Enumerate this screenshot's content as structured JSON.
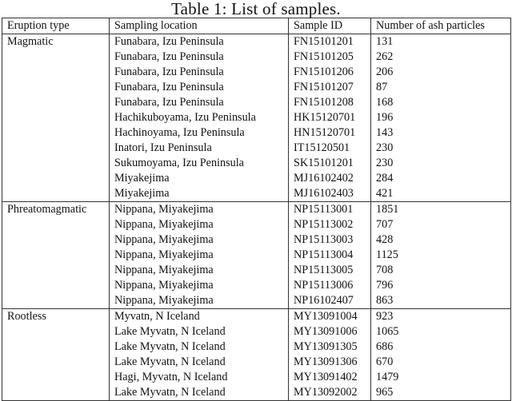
{
  "caption": "Table 1: List of samples.",
  "table": {
    "headers": [
      "Eruption type",
      "Sampling location",
      "Sample ID",
      "Number of ash particles"
    ],
    "groups": [
      {
        "eruption_type": "Magmatic",
        "rows": [
          {
            "location": "Funabara, Izu Peninsula",
            "sample_id": "FN15101201",
            "count": "131"
          },
          {
            "location": "Funabara, Izu Peninsula",
            "sample_id": "FN15101205",
            "count": "262"
          },
          {
            "location": "Funabara, Izu Peninsula",
            "sample_id": "FN15101206",
            "count": "206"
          },
          {
            "location": "Funabara, Izu Peninsula",
            "sample_id": "FN15101207",
            "count": "87"
          },
          {
            "location": "Funabara, Izu Peninsula",
            "sample_id": "FN15101208",
            "count": "168"
          },
          {
            "location": "Hachikuboyama, Izu Peninsula",
            "sample_id": "HK15120701",
            "count": "196"
          },
          {
            "location": "Hachinoyama, Izu Peninsula",
            "sample_id": "HN15120701",
            "count": "143"
          },
          {
            "location": "Inatori, Izu Peninsula",
            "sample_id": "IT15120501",
            "count": "230"
          },
          {
            "location": "Sukumoyama, Izu Peninsula",
            "sample_id": "SK15101201",
            "count": "230"
          },
          {
            "location": "Miyakejima",
            "sample_id": "MJ16102402",
            "count": "284"
          },
          {
            "location": "Miyakejima",
            "sample_id": "MJ16102403",
            "count": "421"
          }
        ]
      },
      {
        "eruption_type": "Phreatomagmatic",
        "rows": [
          {
            "location": "Nippana, Miyakejima",
            "sample_id": "NP15113001",
            "count": "1851"
          },
          {
            "location": "Nippana, Miyakejima",
            "sample_id": "NP15113002",
            "count": "707"
          },
          {
            "location": "Nippana, Miyakejima",
            "sample_id": "NP15113003",
            "count": "428"
          },
          {
            "location": "Nippana, Miyakejima",
            "sample_id": "NP15113004",
            "count": "1125"
          },
          {
            "location": "Nippana, Miyakejima",
            "sample_id": "NP15113005",
            "count": "708"
          },
          {
            "location": "Nippana, Miyakejima",
            "sample_id": "NP15113006",
            "count": "796"
          },
          {
            "location": "Nippana, Miyakejima",
            "sample_id": "NP16102407",
            "count": "863"
          }
        ]
      },
      {
        "eruption_type": "Rootless",
        "rows": [
          {
            "location": "Myvatn, N Iceland",
            "sample_id": "MY13091004",
            "count": "923"
          },
          {
            "location": "Lake Myvatn, N Iceland",
            "sample_id": "MY13091006",
            "count": "1065"
          },
          {
            "location": "Lake Myvatn, N Iceland",
            "sample_id": "MY13091305",
            "count": "686"
          },
          {
            "location": "Lake Myvatn, N Iceland",
            "sample_id": "MY13091306",
            "count": "670"
          },
          {
            "location": "Hagi, Myvatn, N Iceland",
            "sample_id": "MY13091402",
            "count": "1479"
          },
          {
            "location": "Lake Myvatn, N Iceland",
            "sample_id": "MY13092002",
            "count": "965"
          }
        ]
      }
    ]
  }
}
